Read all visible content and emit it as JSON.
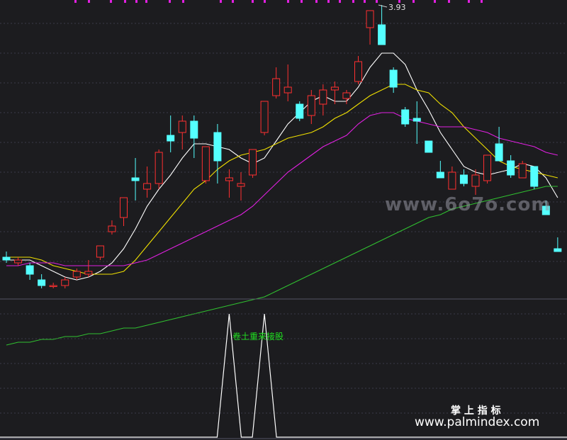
{
  "chart_data": {
    "type": "candlestick",
    "main_panel": {
      "max_price_label": "3.93",
      "candles": [
        {
          "i": 0,
          "open": 3.03,
          "close": 3.04,
          "high": 3.06,
          "low": 3.02,
          "color": "cyan"
        },
        {
          "i": 1,
          "open": 3.02,
          "close": 3.03,
          "high": 3.04,
          "low": 3.01,
          "color": "red"
        },
        {
          "i": 2,
          "open": 3.01,
          "close": 2.98,
          "high": 3.02,
          "low": 2.96,
          "color": "cyan"
        },
        {
          "i": 3,
          "open": 2.96,
          "close": 2.94,
          "high": 2.98,
          "low": 2.93,
          "color": "cyan"
        },
        {
          "i": 4,
          "open": 2.94,
          "close": 2.94,
          "high": 2.95,
          "low": 2.93,
          "color": "red"
        },
        {
          "i": 5,
          "open": 2.94,
          "close": 2.96,
          "high": 2.97,
          "low": 2.93,
          "color": "red"
        },
        {
          "i": 6,
          "open": 2.97,
          "close": 2.99,
          "high": 3.0,
          "low": 2.96,
          "color": "red"
        },
        {
          "i": 7,
          "open": 2.98,
          "close": 2.99,
          "high": 3.03,
          "low": 2.97,
          "color": "red"
        },
        {
          "i": 8,
          "open": 3.04,
          "close": 3.08,
          "high": 3.08,
          "low": 3.03,
          "color": "red"
        },
        {
          "i": 9,
          "open": 3.13,
          "close": 3.15,
          "high": 3.17,
          "low": 3.12,
          "color": "red"
        },
        {
          "i": 10,
          "open": 3.18,
          "close": 3.25,
          "high": 3.25,
          "low": 3.15,
          "color": "red"
        },
        {
          "i": 11,
          "open": 3.32,
          "close": 3.31,
          "high": 3.39,
          "low": 3.24,
          "color": "cyan"
        },
        {
          "i": 12,
          "open": 3.28,
          "close": 3.3,
          "high": 3.36,
          "low": 3.25,
          "color": "red"
        },
        {
          "i": 13,
          "open": 3.3,
          "close": 3.41,
          "high": 3.42,
          "low": 3.28,
          "color": "red"
        },
        {
          "i": 14,
          "open": 3.47,
          "close": 3.45,
          "high": 3.54,
          "low": 3.41,
          "color": "cyan"
        },
        {
          "i": 15,
          "open": 3.48,
          "close": 3.52,
          "high": 3.54,
          "low": 3.42,
          "color": "red"
        },
        {
          "i": 16,
          "open": 3.52,
          "close": 3.46,
          "high": 3.54,
          "low": 3.39,
          "color": "cyan"
        },
        {
          "i": 17,
          "open": 3.31,
          "close": 3.43,
          "high": 3.43,
          "low": 3.3,
          "color": "red"
        },
        {
          "i": 18,
          "open": 3.48,
          "close": 3.38,
          "high": 3.51,
          "low": 3.3,
          "color": "cyan"
        },
        {
          "i": 19,
          "open": 3.32,
          "close": 3.31,
          "high": 3.35,
          "low": 3.25,
          "color": "red"
        },
        {
          "i": 20,
          "open": 3.29,
          "close": 3.3,
          "high": 3.34,
          "low": 3.24,
          "color": "red"
        },
        {
          "i": 21,
          "open": 3.33,
          "close": 3.42,
          "high": 3.42,
          "low": 3.32,
          "color": "red"
        },
        {
          "i": 22,
          "open": 3.48,
          "close": 3.59,
          "high": 3.59,
          "low": 3.47,
          "color": "red"
        },
        {
          "i": 23,
          "open": 3.61,
          "close": 3.67,
          "high": 3.71,
          "low": 3.6,
          "color": "red"
        },
        {
          "i": 24,
          "open": 3.62,
          "close": 3.64,
          "high": 3.72,
          "low": 3.59,
          "color": "red"
        },
        {
          "i": 25,
          "open": 3.58,
          "close": 3.53,
          "high": 3.59,
          "low": 3.52,
          "color": "cyan"
        },
        {
          "i": 26,
          "open": 3.54,
          "close": 3.61,
          "high": 3.63,
          "low": 3.51,
          "color": "red"
        },
        {
          "i": 27,
          "open": 3.58,
          "close": 3.63,
          "high": 3.65,
          "low": 3.54,
          "color": "red"
        },
        {
          "i": 28,
          "open": 3.63,
          "close": 3.64,
          "high": 3.66,
          "low": 3.58,
          "color": "red"
        },
        {
          "i": 29,
          "open": 3.6,
          "close": 3.62,
          "high": 3.63,
          "low": 3.58,
          "color": "red"
        },
        {
          "i": 30,
          "open": 3.66,
          "close": 3.73,
          "high": 3.75,
          "low": 3.65,
          "color": "red"
        },
        {
          "i": 31,
          "open": 3.85,
          "close": 3.91,
          "high": 3.91,
          "low": 3.79,
          "color": "red"
        },
        {
          "i": 32,
          "open": 3.86,
          "close": 3.79,
          "high": 3.93,
          "low": 3.79,
          "color": "cyan"
        },
        {
          "i": 33,
          "open": 3.7,
          "close": 3.64,
          "high": 3.71,
          "low": 3.62,
          "color": "cyan"
        },
        {
          "i": 34,
          "open": 3.56,
          "close": 3.51,
          "high": 3.57,
          "low": 3.5,
          "color": "cyan"
        },
        {
          "i": 35,
          "open": 3.53,
          "close": 3.52,
          "high": 3.59,
          "low": 3.44,
          "color": "cyan"
        },
        {
          "i": 36,
          "open": 3.45,
          "close": 3.41,
          "high": 3.45,
          "low": 3.41,
          "color": "cyan"
        },
        {
          "i": 37,
          "open": 3.34,
          "close": 3.32,
          "high": 3.38,
          "low": 3.32,
          "color": "cyan"
        },
        {
          "i": 38,
          "open": 3.28,
          "close": 3.34,
          "high": 3.36,
          "low": 3.28,
          "color": "red"
        },
        {
          "i": 39,
          "open": 3.33,
          "close": 3.3,
          "high": 3.35,
          "low": 3.29,
          "color": "cyan"
        },
        {
          "i": 40,
          "open": 3.29,
          "close": 3.33,
          "high": 3.35,
          "low": 3.26,
          "color": "red"
        },
        {
          "i": 41,
          "open": 3.31,
          "close": 3.4,
          "high": 3.4,
          "low": 3.3,
          "color": "red"
        },
        {
          "i": 42,
          "open": 3.44,
          "close": 3.38,
          "high": 3.5,
          "low": 3.38,
          "color": "cyan"
        },
        {
          "i": 43,
          "open": 3.38,
          "close": 3.33,
          "high": 3.4,
          "low": 3.32,
          "color": "cyan"
        },
        {
          "i": 44,
          "open": 3.32,
          "close": 3.37,
          "high": 3.38,
          "low": 3.32,
          "color": "red"
        },
        {
          "i": 45,
          "open": 3.36,
          "close": 3.29,
          "high": 3.36,
          "low": 3.28,
          "color": "cyan"
        },
        {
          "i": 46,
          "open": 3.22,
          "close": 3.19,
          "high": 3.24,
          "low": 3.19,
          "color": "cyan"
        },
        {
          "i": 47,
          "open": 3.07,
          "close": 3.06,
          "high": 3.11,
          "low": 3.06,
          "color": "cyan"
        }
      ],
      "moving_averages": [
        {
          "name": "MA5",
          "color": "#ffffff",
          "values": [
            3.03,
            3.03,
            3.03,
            3.01,
            2.99,
            2.97,
            2.96,
            2.97,
            2.99,
            3.02,
            3.07,
            3.14,
            3.22,
            3.28,
            3.33,
            3.39,
            3.44,
            3.44,
            3.43,
            3.42,
            3.39,
            3.37,
            3.39,
            3.45,
            3.51,
            3.55,
            3.59,
            3.61,
            3.59,
            3.59,
            3.64,
            3.71,
            3.76,
            3.76,
            3.72,
            3.63,
            3.56,
            3.48,
            3.42,
            3.36,
            3.34,
            3.33,
            3.34,
            3.35,
            3.37,
            3.36,
            3.32,
            3.25
          ]
        },
        {
          "name": "MA10",
          "color": "#f0e000",
          "values": [
            3.04,
            3.04,
            3.04,
            3.03,
            3.01,
            3.0,
            2.99,
            2.98,
            2.98,
            2.98,
            2.99,
            3.03,
            3.08,
            3.13,
            3.18,
            3.23,
            3.28,
            3.31,
            3.35,
            3.38,
            3.4,
            3.41,
            3.42,
            3.44,
            3.46,
            3.47,
            3.48,
            3.5,
            3.53,
            3.55,
            3.58,
            3.61,
            3.63,
            3.65,
            3.65,
            3.63,
            3.62,
            3.58,
            3.55,
            3.5,
            3.46,
            3.42,
            3.38,
            3.36,
            3.35,
            3.34,
            3.33,
            3.32
          ]
        },
        {
          "name": "MA20",
          "color": "#e020e0",
          "values": [
            3.01,
            3.01,
            3.02,
            3.02,
            3.02,
            3.01,
            3.01,
            3.01,
            3.01,
            3.01,
            3.01,
            3.02,
            3.03,
            3.05,
            3.07,
            3.09,
            3.11,
            3.13,
            3.15,
            3.17,
            3.19,
            3.22,
            3.26,
            3.3,
            3.34,
            3.37,
            3.4,
            3.43,
            3.45,
            3.47,
            3.51,
            3.54,
            3.55,
            3.55,
            3.53,
            3.52,
            3.51,
            3.5,
            3.5,
            3.5,
            3.49,
            3.48,
            3.46,
            3.45,
            3.44,
            3.43,
            3.41,
            3.4
          ]
        },
        {
          "name": "MA60",
          "color": "#30c030",
          "values": [
            2.73,
            2.74,
            2.74,
            2.75,
            2.75,
            2.76,
            2.76,
            2.77,
            2.77,
            2.78,
            2.79,
            2.79,
            2.8,
            2.81,
            2.82,
            2.83,
            2.84,
            2.85,
            2.86,
            2.87,
            2.88,
            2.89,
            2.9,
            2.92,
            2.94,
            2.96,
            2.98,
            3.0,
            3.02,
            3.04,
            3.06,
            3.08,
            3.1,
            3.12,
            3.14,
            3.16,
            3.18,
            3.19,
            3.21,
            3.22,
            3.23,
            3.24,
            3.25,
            3.26,
            3.27,
            3.28,
            3.29,
            3.29
          ]
        }
      ]
    },
    "indicator_panel": {
      "label": "卷土重来接股",
      "values": [
        0,
        0,
        0,
        0,
        0,
        0,
        0,
        0,
        0,
        0,
        0,
        0,
        0,
        0,
        0,
        0,
        0,
        0,
        0,
        1,
        0,
        0,
        1,
        0,
        0,
        0,
        0,
        0,
        0,
        0,
        0,
        0,
        0,
        0,
        0,
        0,
        0,
        0,
        0,
        0,
        0,
        0,
        0,
        0,
        0,
        0,
        0,
        0
      ]
    }
  },
  "watermarks": {
    "top_right": "www.6o7o.com",
    "bottom_title": "掌 上 指 标",
    "bottom_url": "www.palmindex.com"
  },
  "colors": {
    "up": "#ff3030",
    "down": "#54ffff",
    "background": "#1c1c1f",
    "grid": "#3a3a48",
    "indicator_label": "#20e020"
  }
}
